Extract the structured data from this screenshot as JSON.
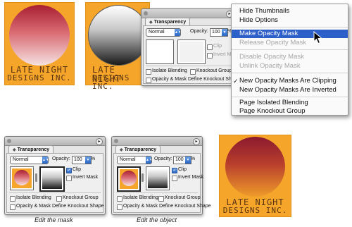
{
  "logo_text": {
    "line1": "LATE NIGHT",
    "line2": "DESIGNS INC."
  },
  "panel": {
    "title": "Transparency",
    "blend_mode": "Normal",
    "opacity_label": "Opacity:",
    "opacity_value": "100",
    "percent": "%",
    "clip_label": "Clip",
    "invert_label": "Invert Mask",
    "isolate_label": "Isolate Blending",
    "knockout_label": "Knockout Group",
    "opacity_mask_label": "Opacity & Mask Define Knockout Shape"
  },
  "menu": {
    "items": [
      {
        "label": "Hide Thumbnails"
      },
      {
        "label": "Hide Options"
      },
      {
        "label": "Make Opacity Mask"
      },
      {
        "label": "Release Opacity Mask"
      },
      {
        "label": "Disable Opacity Mask"
      },
      {
        "label": "Unlink Opacity Mask"
      },
      {
        "label": "New Opacity Masks Are Clipping"
      },
      {
        "label": "New Opacity Masks Are Inverted"
      },
      {
        "label": "Page Isolated Blending"
      },
      {
        "label": "Page Knockout Group"
      }
    ],
    "highlighted_index": 2,
    "checked_index": 6,
    "disabled_indices": [
      3,
      4,
      5
    ]
  },
  "captions": {
    "edit_mask": "Edit the mask",
    "edit_object": "Edit the object"
  },
  "colors": {
    "logo_bg": "#f4a52a",
    "menu_highlight": "#2c5fc8"
  }
}
